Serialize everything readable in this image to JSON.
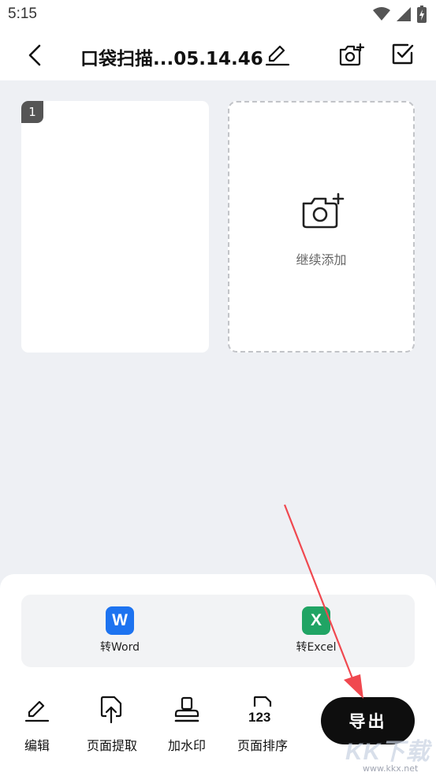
{
  "status_bar": {
    "time": "5:15"
  },
  "header": {
    "title": "口袋扫描...05.14.46"
  },
  "pages": [
    {
      "number": "1"
    }
  ],
  "add_card": {
    "label": "继续添加"
  },
  "convert": {
    "word_label": "转Word",
    "excel_label": "转Excel",
    "word_icon_letter": "W",
    "excel_icon_letter": "X"
  },
  "toolbar": {
    "edit_label": "编辑",
    "extract_label": "页面提取",
    "watermark_label": "加水印",
    "sort_label": "页面排序",
    "export_label": "导出"
  },
  "watermark_logo": {
    "text": "KK下载",
    "url": "www.kkx.net"
  },
  "colors": {
    "background": "#eef0f4",
    "word_blue": "#1d73f0",
    "excel_green": "#20a464",
    "export_black": "#0e0e0e",
    "annotation_arrow": "#f0484f"
  }
}
